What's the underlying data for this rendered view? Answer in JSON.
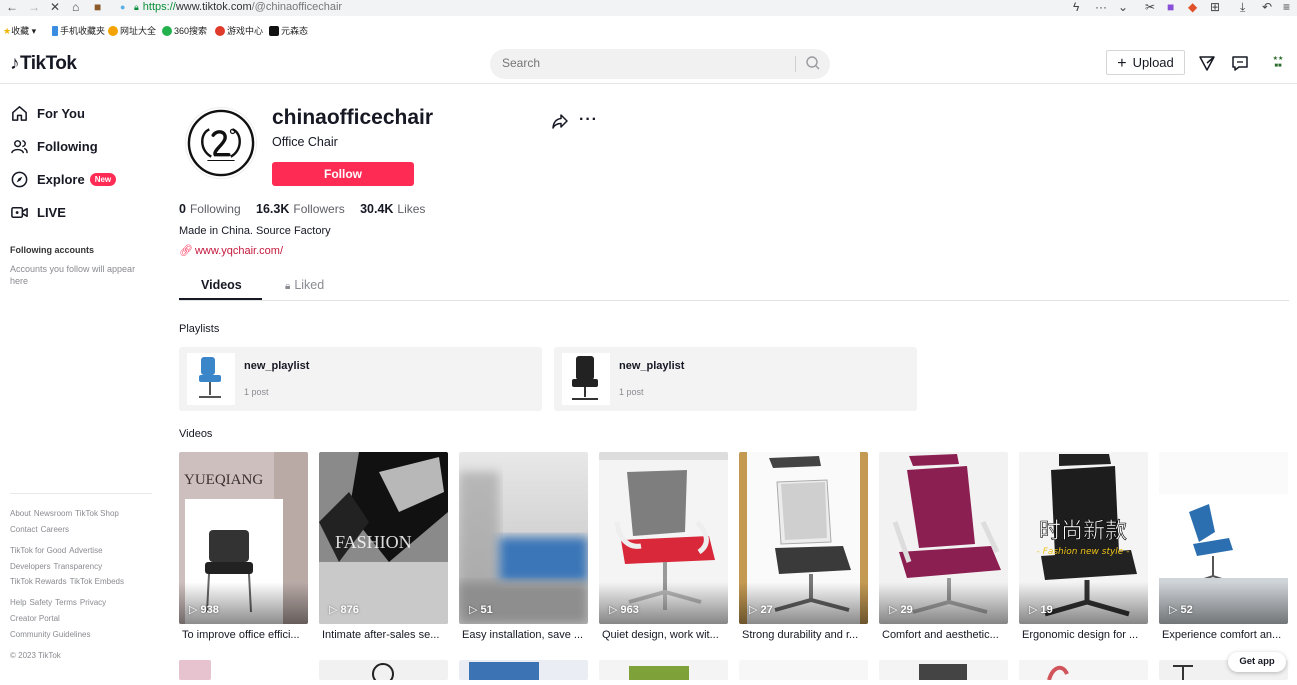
{
  "browser": {
    "url_scheme": "https://",
    "url_host": "www.tiktok.com",
    "url_path": "/@chinaofficechair",
    "bookmarks": [
      "收藏",
      "手机收藏夹",
      "网址大全",
      "360搜索",
      "游戏中心",
      "元森态"
    ]
  },
  "header": {
    "logo": "TikTok",
    "search_placeholder": "Search",
    "upload_label": "Upload"
  },
  "sidebar": {
    "items": [
      {
        "label": "For You",
        "icon": "home-icon"
      },
      {
        "label": "Following",
        "icon": "users-icon"
      },
      {
        "label": "Explore",
        "icon": "compass-icon",
        "badge": "New"
      },
      {
        "label": "LIVE",
        "icon": "live-icon"
      }
    ],
    "following_title": "Following accounts",
    "following_text": "Accounts you follow will appear here",
    "footer": [
      [
        "About",
        "Newsroom",
        "TikTok Shop"
      ],
      [
        "Contact",
        "Careers"
      ],
      [
        "TikTok for Good",
        "Advertise"
      ],
      [
        "Developers",
        "Transparency"
      ],
      [
        "TikTok Rewards",
        "TikTok Embeds"
      ],
      [
        "Help",
        "Safety",
        "Terms",
        "Privacy"
      ],
      [
        "Creator Portal"
      ],
      [
        "Community Guidelines"
      ]
    ],
    "copyright": "© 2023 TikTok"
  },
  "profile": {
    "username": "chinaofficechair",
    "nickname": "Office Chair",
    "follow_label": "Follow",
    "following_count": "0",
    "following_label": "Following",
    "followers_count": "16.3K",
    "followers_label": "Followers",
    "likes_count": "30.4K",
    "likes_label": "Likes",
    "bio": "Made in China. Source Factory",
    "link": "www.yqchair.com/"
  },
  "tabs": {
    "videos": "Videos",
    "liked": "Liked"
  },
  "playlists_title": "Playlists",
  "playlists": [
    {
      "name": "new_playlist",
      "count": "1 post"
    },
    {
      "name": "new_playlist",
      "count": "1 post"
    }
  ],
  "videos_title": "Videos",
  "videos": [
    {
      "views": "938",
      "caption": "To improve office effici...",
      "overlay": "YUEQIANG"
    },
    {
      "views": "876",
      "caption": "Intimate after-sales se...",
      "overlay": "FASHION"
    },
    {
      "views": "51",
      "caption": "Easy installation, save ..."
    },
    {
      "views": "963",
      "caption": "Quiet design, work wit..."
    },
    {
      "views": "27",
      "caption": "Strong durability and r..."
    },
    {
      "views": "29",
      "caption": "Comfort and aesthetic..."
    },
    {
      "views": "19",
      "caption": "Ergonomic design for ...",
      "overlay": "时尚新款",
      "overlay2": "- Fashion new style -"
    },
    {
      "views": "52",
      "caption": "Experience comfort an..."
    }
  ],
  "get_app": "Get app"
}
